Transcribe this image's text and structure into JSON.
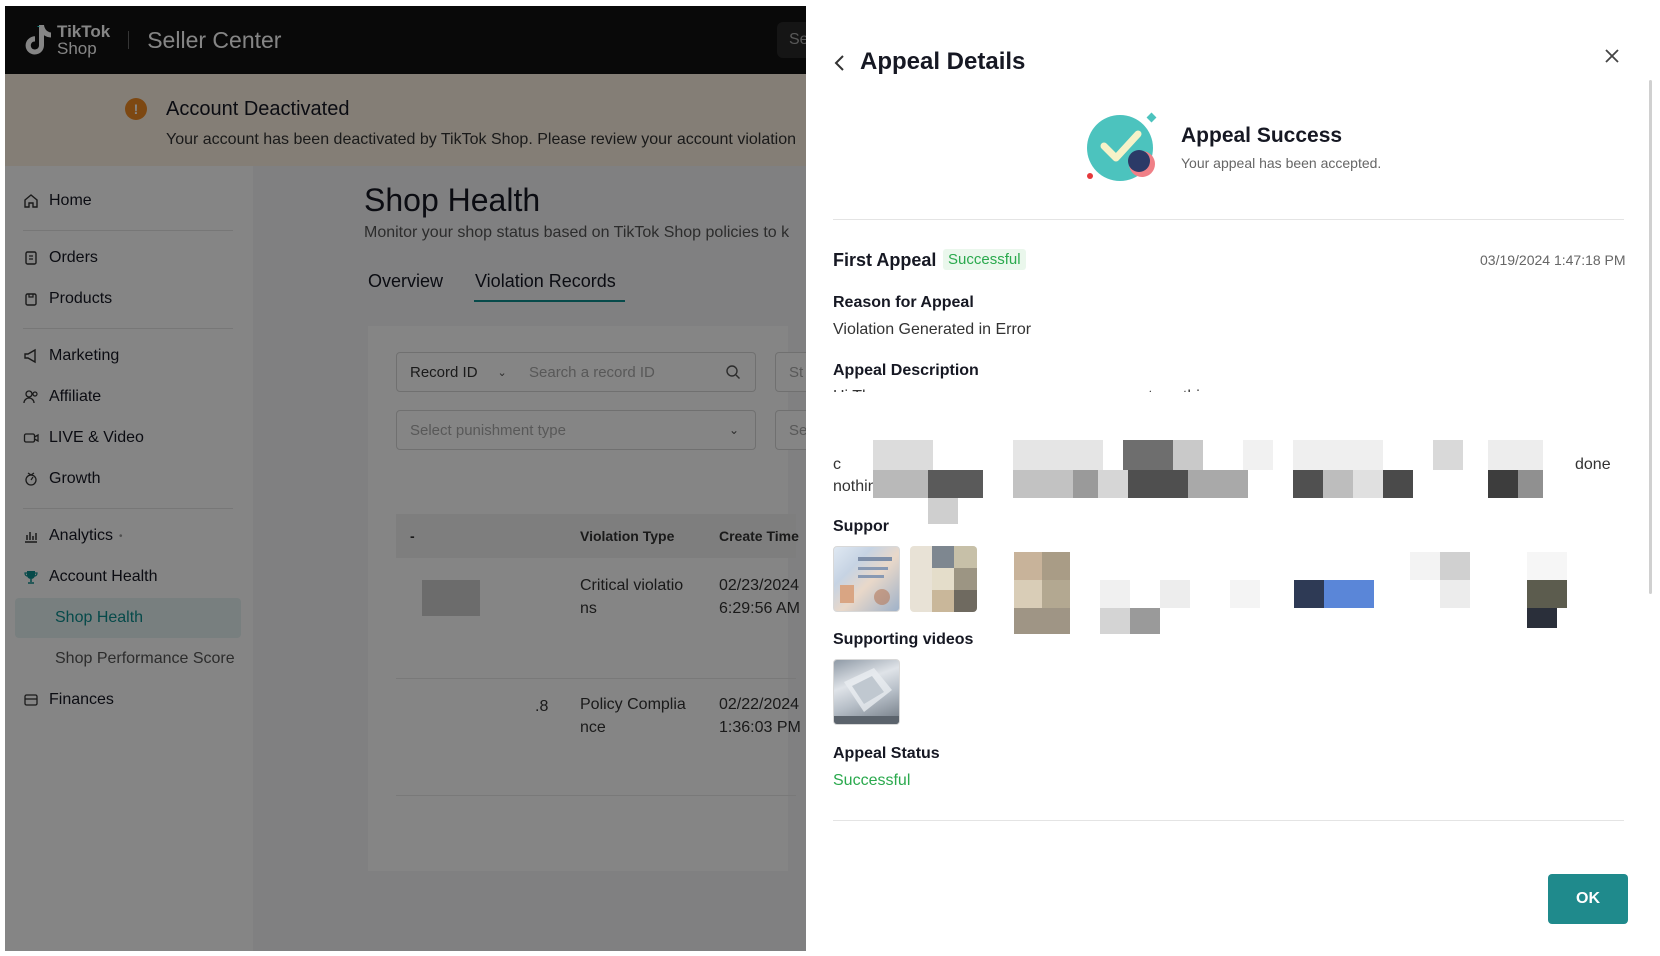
{
  "app": {
    "logo_line1": "TikTok",
    "logo_line2": "Shop",
    "header_title": "Seller Center",
    "search_placeholder": "Se"
  },
  "banner": {
    "icon": "!",
    "title": "Account Deactivated",
    "text": "Your account has been deactivated by TikTok Shop. Please review your account violation"
  },
  "sidebar": {
    "items": [
      {
        "label": "Home",
        "icon": "home-icon"
      },
      {
        "label": "Orders",
        "icon": "orders-icon"
      },
      {
        "label": "Products",
        "icon": "products-icon"
      },
      {
        "label": "Marketing",
        "icon": "megaphone-icon"
      },
      {
        "label": "Affiliate",
        "icon": "affiliate-icon"
      },
      {
        "label": "LIVE & Video",
        "icon": "video-icon"
      },
      {
        "label": "Growth",
        "icon": "growth-icon"
      },
      {
        "label": "Analytics",
        "icon": "analytics-icon"
      },
      {
        "label": "Account Health",
        "icon": "trophy-icon"
      },
      {
        "label": "Shop Health",
        "icon": ""
      },
      {
        "label": "Shop Performance Score",
        "icon": ""
      },
      {
        "label": "Finances",
        "icon": "finances-icon"
      }
    ],
    "new_marker": "•"
  },
  "main": {
    "title": "Shop Health",
    "subtitle": "Monitor your shop status based on TikTok Shop policies to k",
    "tabs": [
      {
        "label": "Overview"
      },
      {
        "label": "Violation Records"
      }
    ],
    "filters": {
      "record_select": "Record ID",
      "record_placeholder": "Search a record ID",
      "status_placeholder": "St",
      "punishment_placeholder": "Select punishment type",
      "other_placeholder": "Se"
    },
    "table": {
      "headers": [
        "-",
        "Violation Type",
        "Create Time"
      ],
      "rows": [
        {
          "id": "...",
          "type_line1": "Critical violatio",
          "type_line2": "ns",
          "time_line1": "02/23/2024",
          "time_line2": "6:29:56 AM"
        },
        {
          "id": ".8",
          "type_line1": "Policy Complia",
          "type_line2": "nce",
          "time_line1": "02/22/2024",
          "time_line2": "1:36:03 PM"
        }
      ]
    }
  },
  "drawer": {
    "title": "Appeal Details",
    "success_title": "Appeal Success",
    "success_subtitle": "Your appeal has been accepted.",
    "appeal": {
      "title": "First Appeal",
      "badge": "Successful",
      "timestamp": "03/19/2024 1:47:18 PM"
    },
    "reason_label": "Reason for Appeal",
    "reason_value": "Violation Generated in Error",
    "description_label": "Appeal Description",
    "description_fragments": {
      "line1_start": "Hi Th",
      "line1_mid": "...act, as thi...",
      "line2_end": "a",
      "line3_start": "c",
      "line3_end": "done",
      "line4_start": "nothing"
    },
    "supporting_label": "Suppor",
    "supporting_videos_label": "Supporting videos",
    "status_label": "Appeal Status",
    "status_value": "Successful",
    "ok_label": "OK"
  },
  "colors": {
    "accent": "#1f8a8c",
    "success": "#2aa94d",
    "warning": "#f08a24"
  }
}
